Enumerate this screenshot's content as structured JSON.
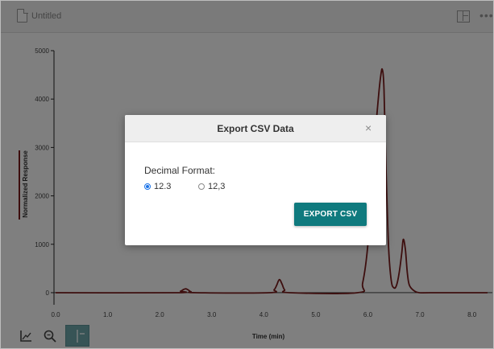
{
  "document": {
    "title": "Untitled"
  },
  "toolbar": {
    "layout_icon": "layout-grid-icon",
    "more_icon": "more-icon",
    "bottom_tools": [
      "axes-icon",
      "zoom-icon",
      "cursor-icon"
    ]
  },
  "dialog": {
    "title": "Export CSV Data",
    "close_label": "×",
    "decimal_label": "Decimal Format:",
    "options": [
      {
        "label": "12.3",
        "selected": true
      },
      {
        "label": "12,3",
        "selected": false
      }
    ],
    "export_label": "EXPORT CSV"
  },
  "colors": {
    "accent": "#0f7a7e",
    "series": "#7a1c1c",
    "radio": "#1a73e8"
  },
  "chart_data": {
    "type": "line",
    "title": "",
    "xlabel": "Time (min)",
    "ylabel": "Normalized Response",
    "xlim": [
      0.0,
      8.3
    ],
    "ylim": [
      -250,
      5000
    ],
    "xticks": [
      "0.0",
      "1.0",
      "2.0",
      "3.0",
      "4.0",
      "5.0",
      "6.0",
      "7.0",
      "8.0"
    ],
    "yticks": [
      "0",
      "1000",
      "2000",
      "3000",
      "4000",
      "5000"
    ],
    "series": [
      {
        "name": "",
        "x": [
          0.0,
          2.3,
          2.4,
          2.45,
          2.5,
          2.55,
          2.6,
          2.7,
          4.1,
          4.2,
          4.25,
          4.3,
          4.35,
          4.4,
          4.5,
          5.8,
          5.9,
          6.0,
          6.1,
          6.2,
          6.25,
          6.28,
          6.31,
          6.35,
          6.4,
          6.45,
          6.5,
          6.55,
          6.6,
          6.65,
          6.68,
          6.72,
          6.76,
          6.8,
          6.9,
          7.0,
          7.2,
          8.3
        ],
        "y": [
          0,
          0,
          30,
          60,
          80,
          55,
          20,
          0,
          0,
          60,
          160,
          270,
          180,
          60,
          0,
          0,
          200,
          1000,
          2700,
          4000,
          4500,
          4600,
          4200,
          2500,
          900,
          250,
          100,
          150,
          400,
          800,
          1100,
          900,
          400,
          150,
          30,
          0,
          0,
          0
        ]
      }
    ]
  }
}
